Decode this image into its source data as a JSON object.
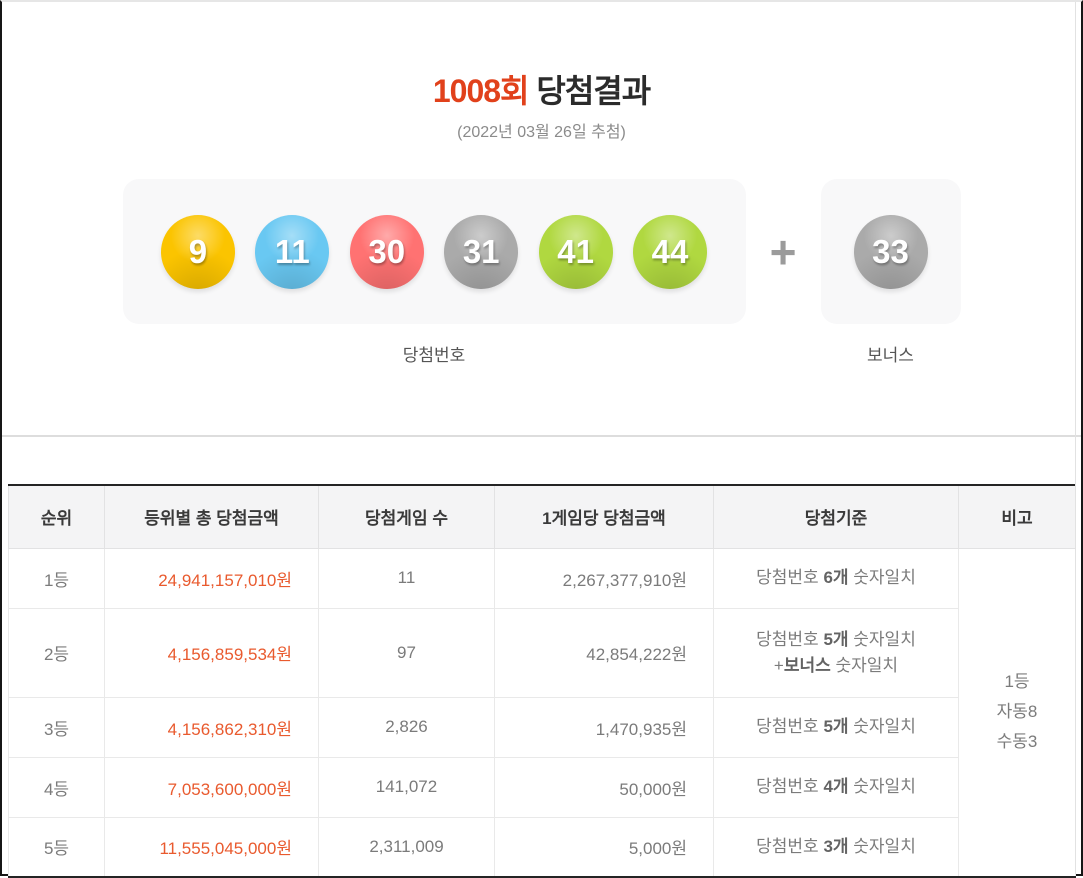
{
  "colors": {
    "title_red": "#e1411b",
    "amount_red": "#e95a2e",
    "ball_yellow": "#fbc400",
    "ball_blue": "#69c8f2",
    "ball_red": "#ff7272",
    "ball_gray": "#aaaaaa",
    "ball_green": "#b0d840"
  },
  "header": {
    "round": "1008회",
    "title_rest": " 당첨결과",
    "date": "(2022년 03월 26일 추첨)"
  },
  "draw": {
    "numbers": [
      {
        "value": "9",
        "color": "#fbc400"
      },
      {
        "value": "11",
        "color": "#69c8f2"
      },
      {
        "value": "30",
        "color": "#ff7272"
      },
      {
        "value": "31",
        "color": "#aaaaaa"
      },
      {
        "value": "41",
        "color": "#b0d840"
      },
      {
        "value": "44",
        "color": "#b0d840"
      }
    ],
    "plus": "+",
    "bonus": {
      "value": "33",
      "color": "#aaaaaa"
    },
    "numbers_label": "당첨번호",
    "bonus_label": "보너스"
  },
  "table": {
    "headers": [
      "순위",
      "등위별 총 당첨금액",
      "당첨게임 수",
      "1게임당 당첨금액",
      "당첨기준",
      "비고"
    ],
    "rows": [
      {
        "rank": "1등",
        "total": "24,941,157,010원",
        "games": "11",
        "per_game": "2,267,377,910원",
        "criteria": [
          {
            "pre": "당첨번호 ",
            "bold": "6개",
            "post": " 숫자일치"
          }
        ]
      },
      {
        "rank": "2등",
        "total": "4,156,859,534원",
        "games": "97",
        "per_game": "42,854,222원",
        "criteria": [
          {
            "pre": "당첨번호 ",
            "bold": "5개",
            "post": " 숫자일치"
          },
          {
            "pre": "+",
            "bold": "보너스",
            "post": " 숫자일치"
          }
        ]
      },
      {
        "rank": "3등",
        "total": "4,156,862,310원",
        "games": "2,826",
        "per_game": "1,470,935원",
        "criteria": [
          {
            "pre": "당첨번호 ",
            "bold": "5개",
            "post": " 숫자일치"
          }
        ]
      },
      {
        "rank": "4등",
        "total": "7,053,600,000원",
        "games": "141,072",
        "per_game": "50,000원",
        "criteria": [
          {
            "pre": "당첨번호 ",
            "bold": "4개",
            "post": " 숫자일치"
          }
        ]
      },
      {
        "rank": "5등",
        "total": "11,555,045,000원",
        "games": "2,311,009",
        "per_game": "5,000원",
        "criteria": [
          {
            "pre": "당첨번호 ",
            "bold": "3개",
            "post": " 숫자일치"
          }
        ]
      }
    ],
    "note_lines": [
      "1등",
      "자동8",
      "수동3"
    ]
  }
}
